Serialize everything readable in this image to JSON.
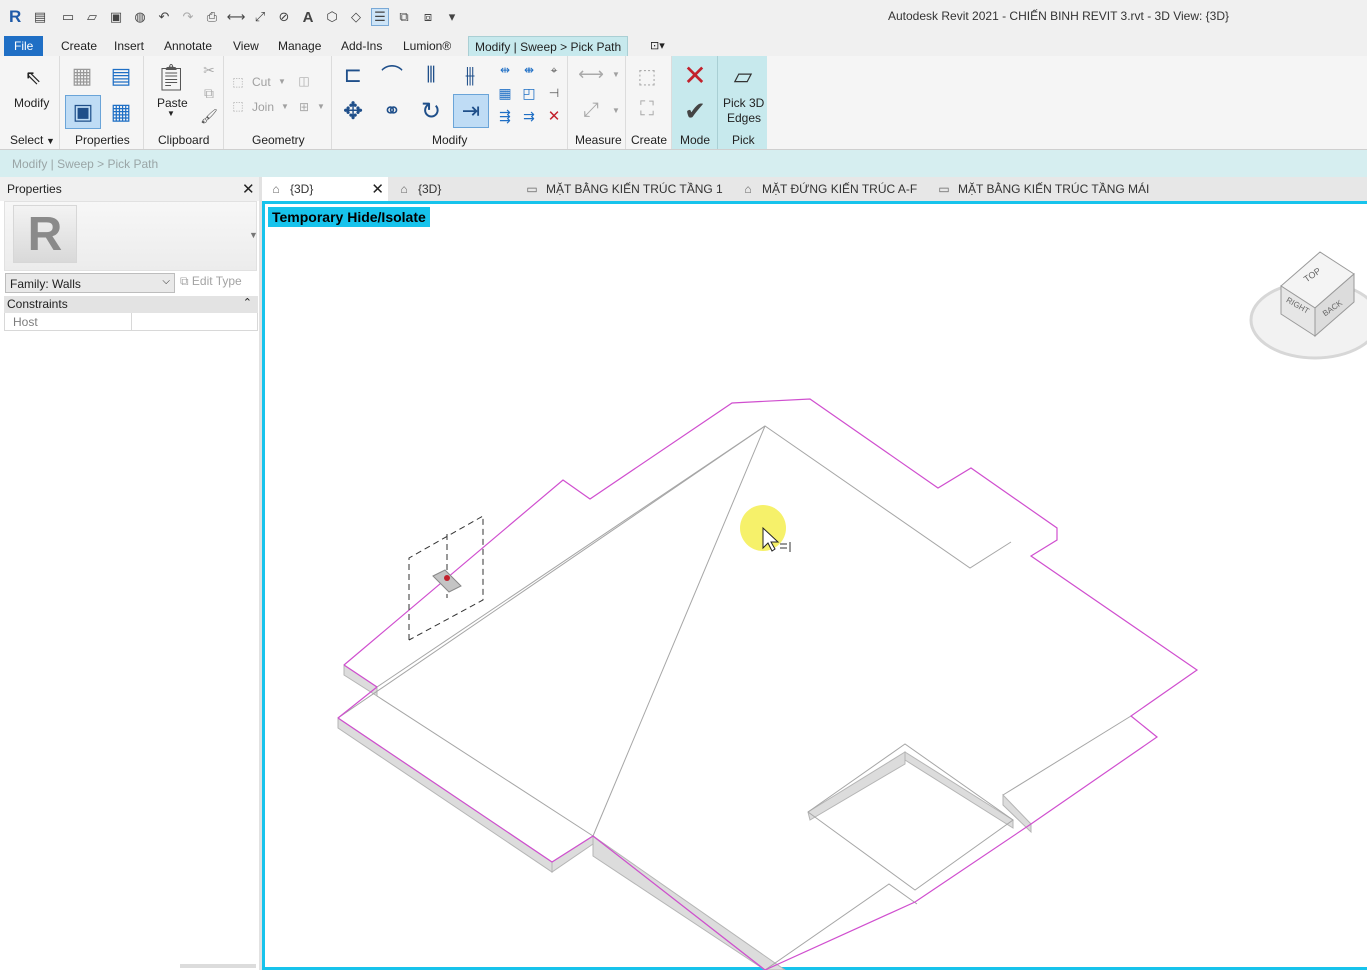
{
  "app": {
    "title": "Autodesk Revit 2021 - CHIẾN BINH REVIT 3.rvt - 3D View: {3D}",
    "logo_letter": "R"
  },
  "quick_access": {
    "icons": [
      "open-icon",
      "new-icon",
      "folder-icon",
      "save-icon",
      "sync-icon",
      "undo-icon",
      "redo-icon",
      "print-icon",
      "measure-icon",
      "dimension-icon",
      "tag-icon",
      "text-icon",
      "3d-view-icon",
      "section-icon",
      "thin-lines-icon",
      "close-hidden-icon",
      "switch-windows-icon",
      "customize-icon"
    ]
  },
  "ribbon_tabs": {
    "file": "File",
    "create": "Create",
    "insert": "Insert",
    "annotate": "Annotate",
    "view": "View",
    "manage": "Manage",
    "addins": "Add-Ins",
    "lumion": "Lumion®",
    "contextual": "Modify | Sweep > Pick Path"
  },
  "ribbon": {
    "modify": "Modify",
    "select": "Select",
    "select_arrow": "▼",
    "properties": "Properties",
    "paste": "Paste",
    "clipboard": "Clipboard",
    "cut": "Cut",
    "join": "Join",
    "geometry": "Geometry",
    "modify_group": "Modify",
    "measure": "Measure",
    "create": "Create",
    "mode": "Mode",
    "pick3d_1": "Pick 3D",
    "pick3d_2": "Edges",
    "pick": "Pick"
  },
  "options_bar": {
    "breadcrumb": "Modify | Sweep > Pick Path"
  },
  "properties_panel": {
    "title": "Properties",
    "close": "✕",
    "logo_letter": "R",
    "family": "Family: Walls",
    "edit_type": "Edit Type",
    "group": "Constraints",
    "row_key": "Host",
    "row_value": ""
  },
  "view_tabs": [
    {
      "label": "{3D}",
      "active": true,
      "icon": "3d-house-icon"
    },
    {
      "label": "{3D}",
      "active": false,
      "icon": "3d-house-icon"
    },
    {
      "label": "MẶT BẰNG KIẾN TRÚC TẦNG 1",
      "active": false,
      "icon": "floor-plan-icon"
    },
    {
      "label": "MẶT ĐỨNG KIẾN TRÚC A-F",
      "active": false,
      "icon": "elevation-icon"
    },
    {
      "label": "MẶT BẰNG KIẾN TRÚC TẦNG MÁI",
      "active": false,
      "icon": "floor-plan-icon"
    }
  ],
  "canvas": {
    "banner": "Temporary Hide/Isolate",
    "viewcube": {
      "top": "TOP",
      "right": "RIGHT",
      "back": "BACK"
    },
    "colors": {
      "edge_selected": "#d04fcf",
      "edge": "#9a9a9a",
      "border": "#17c3ec",
      "cursor_highlight": "#f5ef5a"
    }
  }
}
